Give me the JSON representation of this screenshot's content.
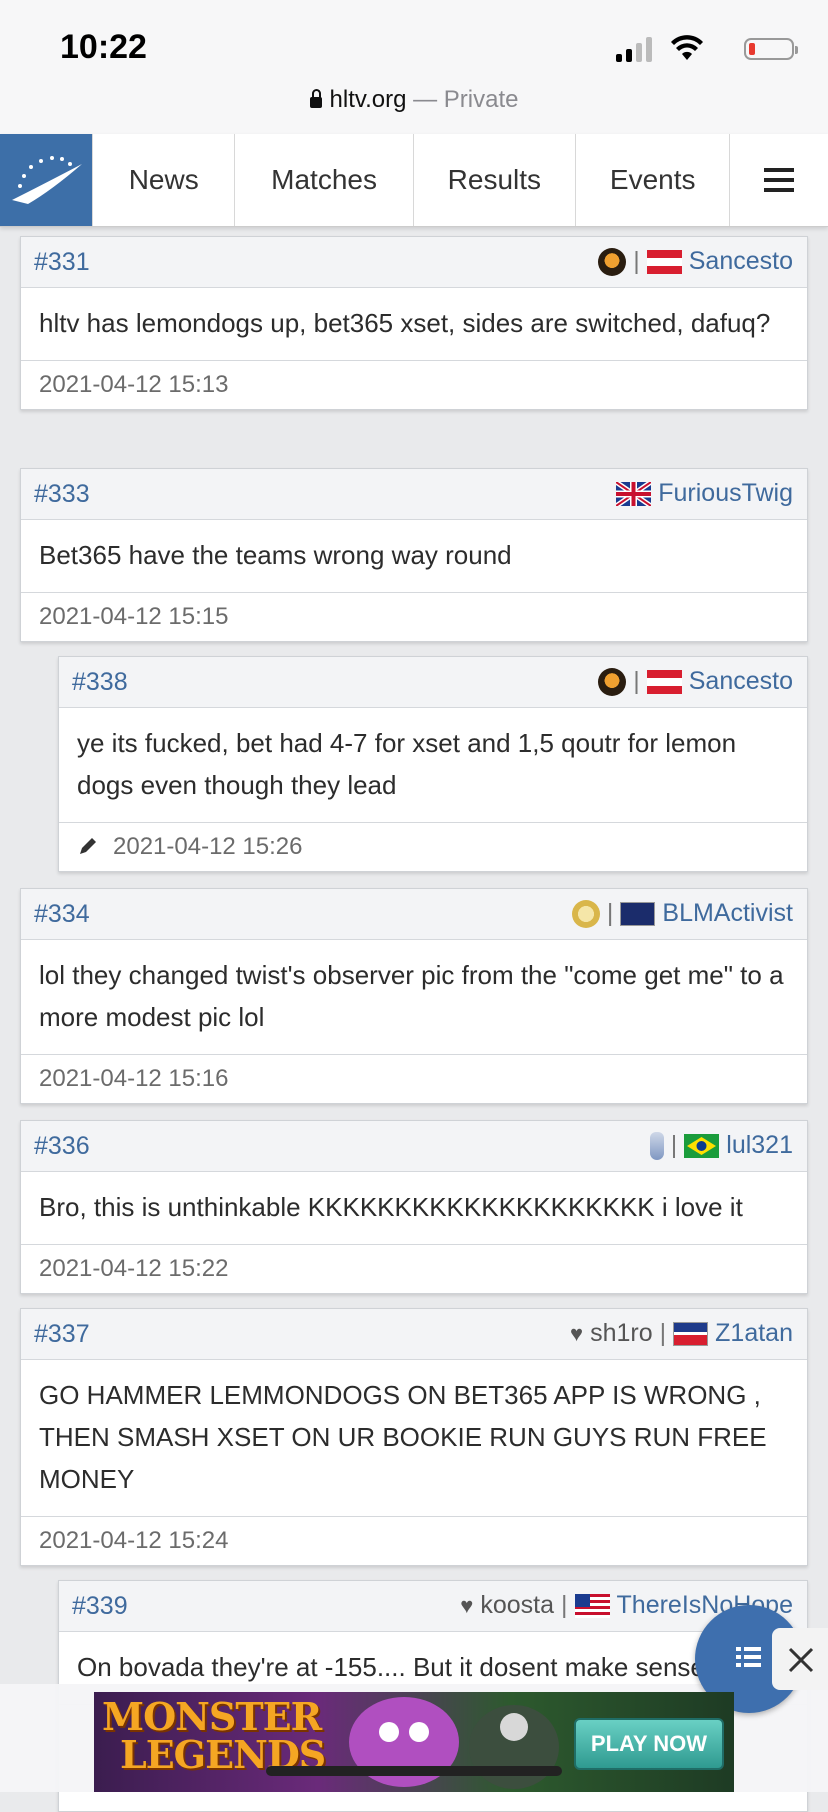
{
  "status_bar": {
    "time": "10:22"
  },
  "browser": {
    "domain": "hltv.org",
    "suffix": " — Private"
  },
  "nav": {
    "items": [
      "News",
      "Matches",
      "Results",
      "Events"
    ]
  },
  "posts": [
    {
      "num": "#331",
      "author": "Sancesto",
      "body": "hltv has lemondogs up, bet365 xset, sides are switched, dafuq?",
      "date": "2021-04-12 15:13"
    },
    {
      "num": "#333",
      "author": "FuriousTwig",
      "body": "Bet365 have the teams wrong way round",
      "date": "2021-04-12 15:15"
    },
    {
      "num": "#338",
      "author": "Sancesto",
      "body": "ye its fucked, bet had 4-7 for xset and 1,5 qoutr for lemon dogs even though they lead",
      "date": "2021-04-12 15:26"
    },
    {
      "num": "#334",
      "author": "BLMActivist",
      "body": "lol they changed twist's observer pic from the \"come get me\" to a more modest pic lol",
      "date": "2021-04-12 15:16"
    },
    {
      "num": "#336",
      "author": "lul321",
      "body": "Bro, this is unthinkable KKKKKKKKKKKKKKKKKKKK i love it",
      "date": "2021-04-12 15:22"
    },
    {
      "num": "#337",
      "author": "Z1atan",
      "fan": "sh1ro",
      "body": "GO HAMMER LEMMONDOGS ON BET365 APP IS WRONG , THEN SMASH XSET ON UR BOOKIE RUN GUYS RUN FREE MONEY",
      "date": "2021-04-12 15:24"
    },
    {
      "num": "#339",
      "author": "ThereIsNoHope",
      "fan": "koosta",
      "body": "On bovada they're at -155.... But it dosent make sense",
      "date": ""
    }
  ],
  "separator": "|",
  "ad": {
    "title_line1": "MONSTER",
    "title_line2": "LEGENDS",
    "button": "PLAY NOW"
  }
}
